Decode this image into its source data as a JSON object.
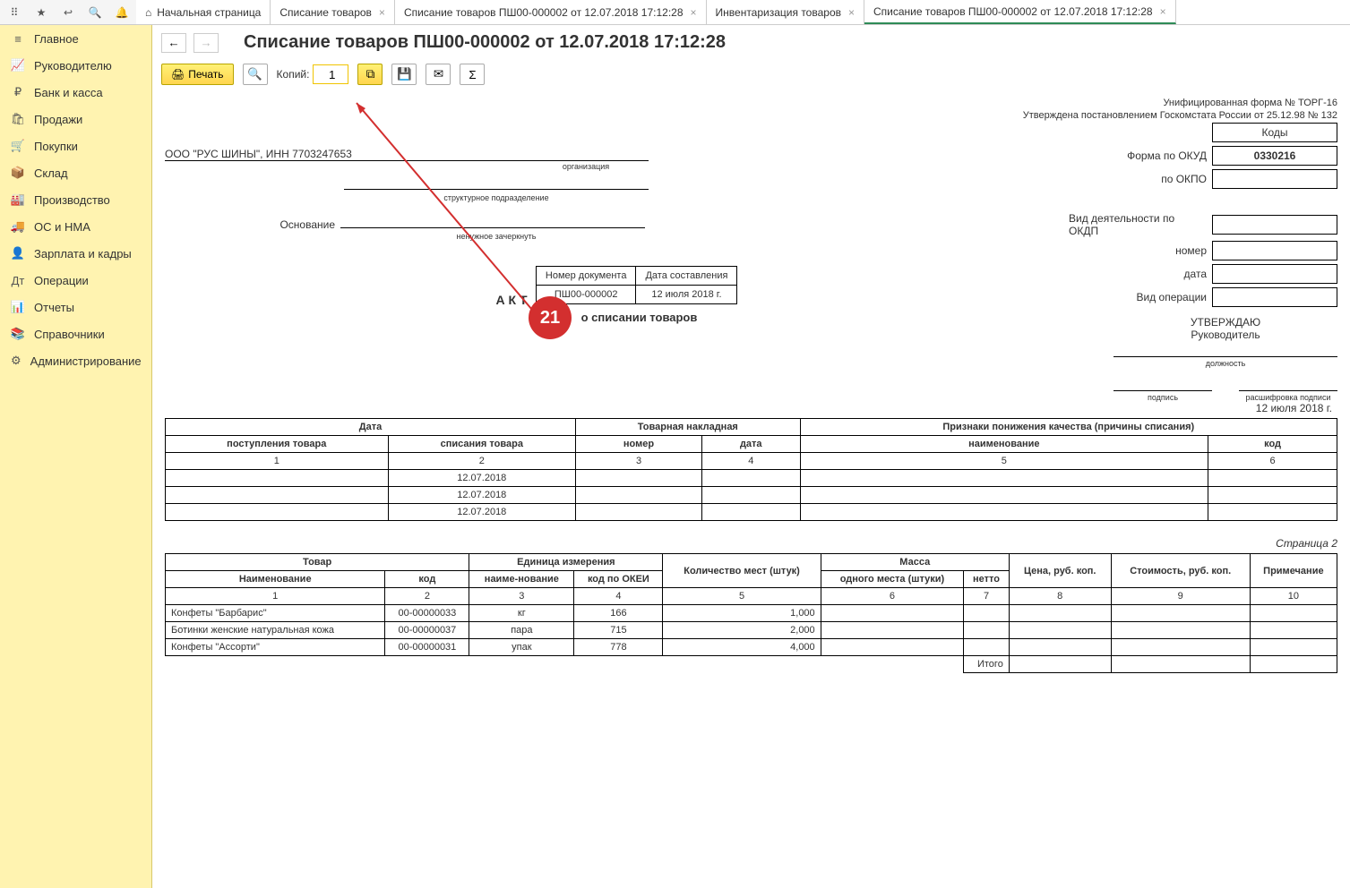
{
  "toolbar_icons": [
    "apps",
    "star",
    "link",
    "search",
    "bell"
  ],
  "tabs": [
    {
      "label": "Начальная страница",
      "home": true
    },
    {
      "label": "Списание товаров",
      "close": true
    },
    {
      "label": "Списание товаров ПШ00-000002 от 12.07.2018 17:12:28",
      "close": true
    },
    {
      "label": "Инвентаризация товаров",
      "close": true
    },
    {
      "label": "Списание товаров ПШ00-000002 от 12.07.2018 17:12:28",
      "close": true,
      "active": true
    }
  ],
  "sidebar": [
    {
      "icon": "≡",
      "label": "Главное"
    },
    {
      "icon": "📈",
      "label": "Руководителю"
    },
    {
      "icon": "₽",
      "label": "Банк и касса"
    },
    {
      "icon": "🛍",
      "label": "Продажи"
    },
    {
      "icon": "🛒",
      "label": "Покупки"
    },
    {
      "icon": "📦",
      "label": "Склад"
    },
    {
      "icon": "🏭",
      "label": "Производство"
    },
    {
      "icon": "🚚",
      "label": "ОС и НМА"
    },
    {
      "icon": "👤",
      "label": "Зарплата и кадры"
    },
    {
      "icon": "Дт",
      "label": "Операции"
    },
    {
      "icon": "📊",
      "label": "Отчеты"
    },
    {
      "icon": "📚",
      "label": "Справочники"
    },
    {
      "icon": "⚙",
      "label": "Администрирование"
    }
  ],
  "page_title": "Списание товаров ПШ00-000002 от 12.07.2018 17:12:28",
  "print_btn": "Печать",
  "copies_label": "Копий:",
  "copies_value": "1",
  "callout": "21",
  "form_header1": "Унифицированная форма № ТОРГ-16",
  "form_header2": "Утверждена постановлением Госкомстата России от 25.12.98 № 132",
  "codes_title": "Коды",
  "okud_label": "Форма по ОКУД",
  "okud_value": "0330216",
  "okpo_label": "по ОКПО",
  "okdp_label": "Вид деятельности по ОКДП",
  "num_label": "номер",
  "date_label": "дата",
  "oper_label": "Вид операции",
  "org_value": "ООО \"РУС ШИНЫ\", ИНН 7703247653",
  "org_sub": "организация",
  "dept_sub": "структурное подразделение",
  "reason_label": "Основание",
  "reason_sub": "ненужное зачеркнуть",
  "approve_title": "УТВЕРЖДАЮ",
  "approve_role": "Руководитель",
  "approve_pos": "должность",
  "approve_sign": "подпись",
  "approve_decode": "расшифровка подписи",
  "akt_label": "А К Т",
  "akt_sub": "о списании товаров",
  "akt_cols": [
    "Номер документа",
    "Дата составления"
  ],
  "akt_vals": [
    "ПШ00-000002",
    "12 июля 2018 г."
  ],
  "date_right": "12 июля 2018 г.",
  "t1": {
    "g1": "Дата",
    "g2": "Товарная накладная",
    "g3": "Признаки понижения качества (причины списания)",
    "h": [
      "поступления товара",
      "списания товара",
      "номер",
      "дата",
      "наименование",
      "код"
    ],
    "n": [
      "1",
      "2",
      "3",
      "4",
      "5",
      "6"
    ],
    "rows": [
      [
        "",
        "12.07.2018",
        "",
        "",
        "",
        ""
      ],
      [
        "",
        "12.07.2018",
        "",
        "",
        "",
        ""
      ],
      [
        "",
        "12.07.2018",
        "",
        "",
        "",
        ""
      ]
    ]
  },
  "page2_label": "Страница 2",
  "t2": {
    "g": [
      "Товар",
      "Единица измерения",
      "Количество мест (штук)",
      "Масса",
      "Цена, руб. коп.",
      "Стоимость, руб. коп.",
      "Примечание"
    ],
    "h": [
      "Наименование",
      "код",
      "наиме-нование",
      "код по ОКЕИ",
      "",
      "одного места (штуки)",
      "нетто",
      "",
      "",
      ""
    ],
    "n": [
      "1",
      "2",
      "3",
      "4",
      "5",
      "6",
      "7",
      "8",
      "9",
      "10"
    ],
    "rows": [
      [
        "Конфеты \"Барбарис\"",
        "00-00000033",
        "кг",
        "166",
        "1,000",
        "",
        "",
        "",
        "",
        ""
      ],
      [
        "Ботинки женские натуральная кожа",
        "00-00000037",
        "пара",
        "715",
        "2,000",
        "",
        "",
        "",
        "",
        ""
      ],
      [
        "Конфеты \"Ассорти\"",
        "00-00000031",
        "упак",
        "778",
        "4,000",
        "",
        "",
        "",
        "",
        ""
      ]
    ],
    "total": "Итого"
  }
}
